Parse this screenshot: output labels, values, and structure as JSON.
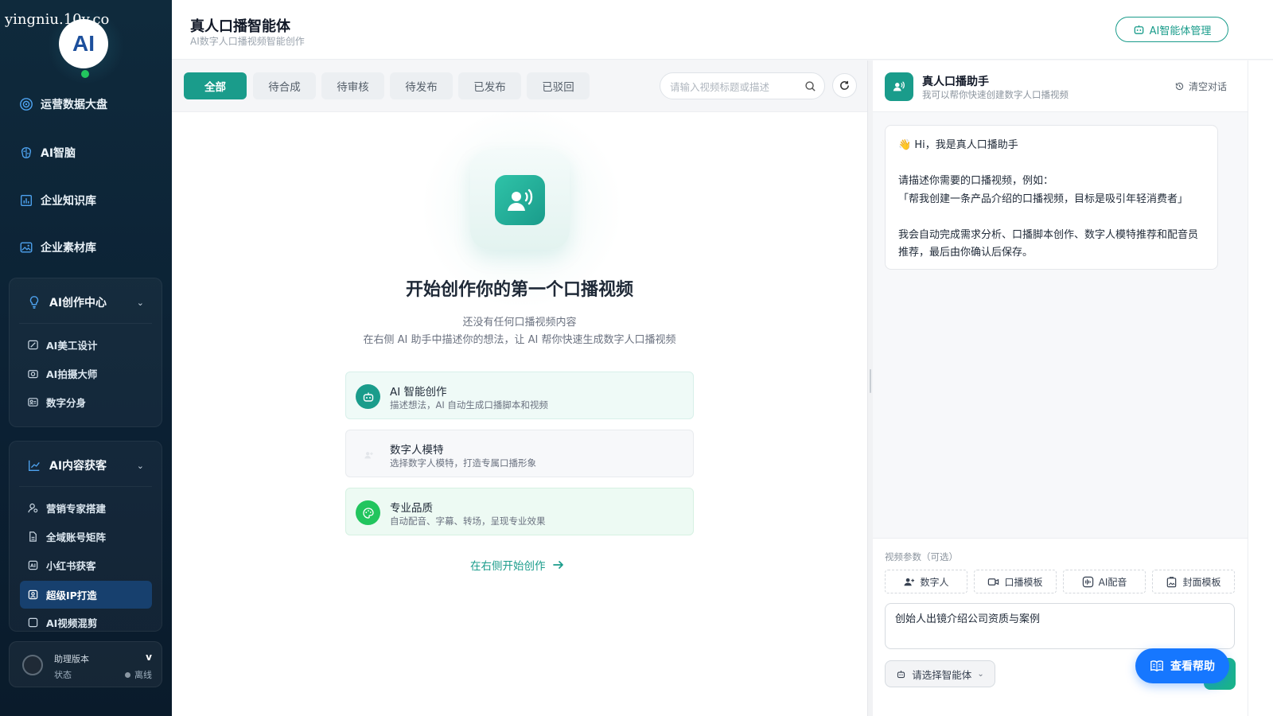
{
  "watermark": "yingniu.10v.co",
  "logo_text": "AI",
  "sidebar": {
    "nav": [
      {
        "label": "运营数据大盘",
        "icon": "target-icon"
      },
      {
        "label": "AI智脑",
        "icon": "brain-icon"
      },
      {
        "label": "企业知识库",
        "icon": "book-chart-icon"
      },
      {
        "label": "企业素材库",
        "icon": "image-icon"
      }
    ],
    "group_create": {
      "title": "AI创作中心",
      "items": [
        {
          "label": "AI美工设计"
        },
        {
          "label": "AI拍摄大师"
        },
        {
          "label": "数字分身"
        }
      ]
    },
    "group_content": {
      "title": "AI内容获客",
      "items": [
        {
          "label": "营销专家搭建"
        },
        {
          "label": "全域账号矩阵"
        },
        {
          "label": "小红书获客"
        },
        {
          "label": "超级IP打造"
        },
        {
          "label": "AI视频混剪"
        }
      ],
      "active_index": 3
    },
    "bottom": {
      "version_label": "助理版本",
      "version": "v",
      "status_label": "状态",
      "status": "离线"
    }
  },
  "header": {
    "title": "真人口播智能体",
    "subtitle": "AI数字人口播视频智能创作",
    "manage_button": "AI智能体管理"
  },
  "filters": {
    "tabs": [
      "全部",
      "待合成",
      "待审核",
      "待发布",
      "已发布",
      "已驳回"
    ],
    "active": 0,
    "search_placeholder": "请输入视频标题或描述"
  },
  "empty": {
    "title": "开始创作你的第一个口播视频",
    "line1": "还没有任何口播视频内容",
    "line2": "在右侧 AI 助手中描述你的想法，让 AI 帮你快速生成数字人口播视频",
    "features": [
      {
        "title": "AI 智能创作",
        "desc": "描述想法，AI 自动生成口播脚本和视频"
      },
      {
        "title": "数字人模特",
        "desc": "选择数字人模特，打造专属口播形象"
      },
      {
        "title": "专业品质",
        "desc": "自动配音、字幕、转场，呈现专业效果"
      }
    ],
    "cta": "在右侧开始创作"
  },
  "assistant": {
    "title": "真人口播助手",
    "subtitle": "我可以帮你快速创建数字人口播视频",
    "clear": "清空对话",
    "greeting": "👋  Hi，我是真人口播助手",
    "prompt_line": "请描述你需要的口播视频，例如：",
    "example": "「帮我创建一条产品介绍的口播视频，目标是吸引年轻消费者」",
    "detail": "我会自动完成需求分析、口播脚本创作、数字人模特推荐和配音员推荐，最后由你确认后保存。",
    "params_label": "视频参数（可选）",
    "param_buttons": [
      "数字人",
      "口播模板",
      "AI配音",
      "封面模板"
    ],
    "input_value": "创始人出镜介绍公司资质与案例",
    "agent_select": "请选择智能体",
    "help_button": "查看帮助"
  },
  "colors": {
    "accent": "#1a9c8b",
    "sidebar_bg": "#0f2a3c",
    "help_blue": "#1677ff",
    "online_green": "#22c55e"
  }
}
